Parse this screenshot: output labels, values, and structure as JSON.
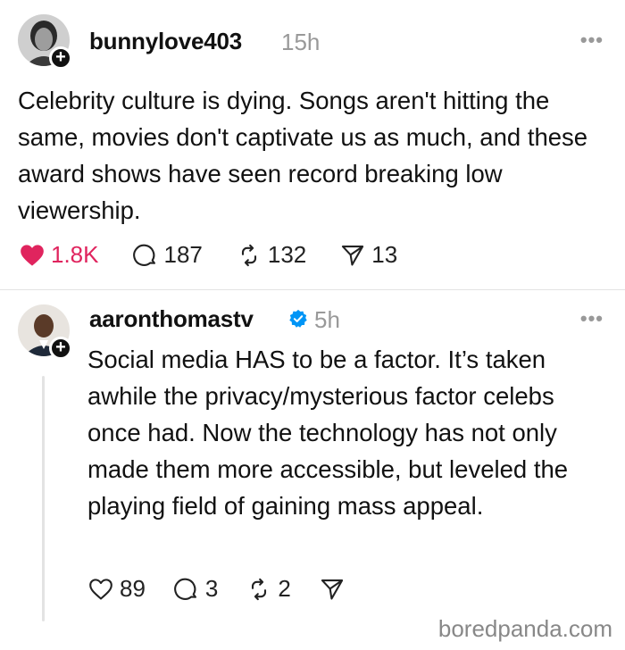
{
  "posts": [
    {
      "username": "bunnylove403",
      "time": "15h",
      "text": "Celebrity culture is dying. Songs aren't hitting the same, movies don't captivate us as much, and these award shows have seen record breaking low viewership.",
      "likes": "1.8K",
      "comments": "187",
      "reposts": "132",
      "shares": "13",
      "liked": true
    },
    {
      "username": "aaronthomastv",
      "verified": true,
      "time": "5h",
      "text": "Social media HAS to be a factor. It’s taken awhile the privacy/mysterious factor celebs once had. Now the technology has not only made them more accessible, but leveled the playing field of gaining mass appeal.",
      "likes": "89",
      "comments": "3",
      "reposts": "2",
      "liked": false
    }
  ],
  "colors": {
    "like_active": "#e0245e",
    "verified": "#0095f6",
    "muted": "#999999"
  },
  "watermark": "boredpanda.com"
}
